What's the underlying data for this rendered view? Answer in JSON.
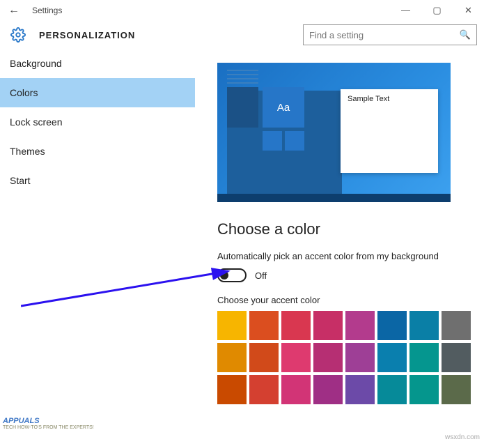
{
  "window": {
    "title": "Settings"
  },
  "header": {
    "title": "PERSONALIZATION",
    "search_placeholder": "Find a setting"
  },
  "sidebar": {
    "items": [
      {
        "label": "Background"
      },
      {
        "label": "Colors"
      },
      {
        "label": "Lock screen"
      },
      {
        "label": "Themes"
      },
      {
        "label": "Start"
      }
    ],
    "active_index": 1
  },
  "preview": {
    "window_text": "Sample Text",
    "tile_text": "Aa"
  },
  "content": {
    "section_title": "Choose a color",
    "auto_pick_label": "Automatically pick an accent color from my background",
    "toggle_state": "Off",
    "accent_label": "Choose your accent color"
  },
  "palette": [
    "#f7b500",
    "#db4e1f",
    "#d93750",
    "#c72f66",
    "#b33b8d",
    "#0b66a5",
    "#0a7fa6",
    "#6f6f6f",
    "#e08a00",
    "#d14a1a",
    "#de3a6f",
    "#b62f73",
    "#9e3f96",
    "#0a7fae",
    "#05968f",
    "#525c60",
    "#c94a00",
    "#d44030",
    "#d23476",
    "#9f2f85",
    "#6c4aa8",
    "#068a99",
    "#05968d",
    "#5b6a4a"
  ],
  "watermark": "wsxdn.com",
  "logo": {
    "name": "APPUALS",
    "tag": "TECH HOW-TO'S FROM THE EXPERTS!"
  }
}
